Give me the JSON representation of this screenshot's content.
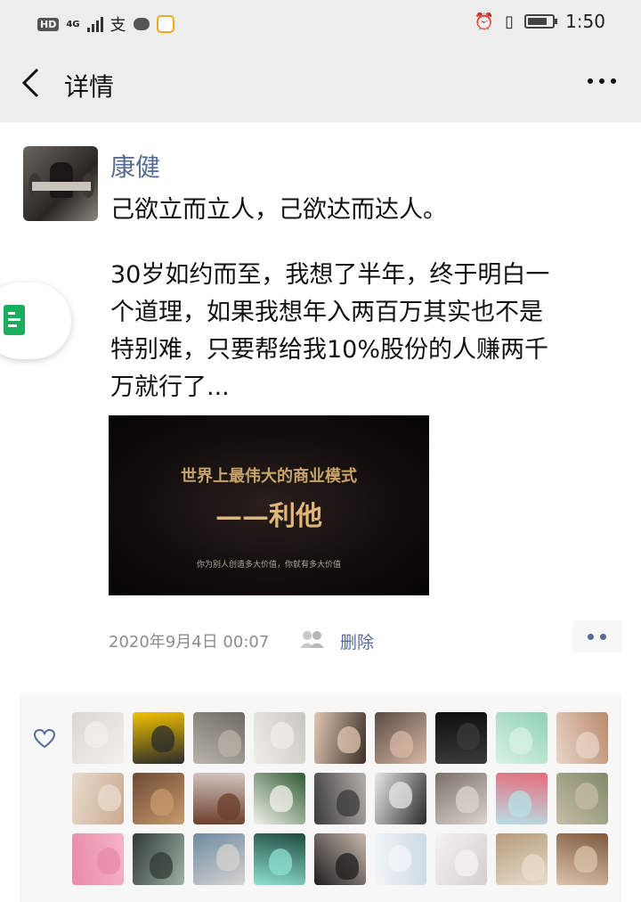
{
  "status_bar": {
    "network": "4G",
    "time": "1:50"
  },
  "nav": {
    "back_icon": "chevron-left-icon",
    "title": "详情",
    "more_icon": "ellipsis-icon"
  },
  "post": {
    "author": "康健",
    "line1": "己欲立而立人，己欲达而达人。",
    "body_lines": [
      "30岁如约而至，我想了半年，终于明白一",
      "个道理，如果我想年入两百万其实也不是",
      "特别难，只要帮给我10%股份的人赚两千",
      "万就行了..."
    ],
    "image": {
      "title": "世界上最伟大的商业模式",
      "main": "——利他",
      "subtitle": "你为别人创造多大价值，你就有多大价值"
    },
    "timestamp": "2020年9月4日 00:07",
    "delete_label": "删除"
  },
  "likes": {
    "avatars": [
      {
        "color": "#dcd7d2",
        "accent": "#f3efe9"
      },
      {
        "color": "#f2c200",
        "accent": "#2b2b2b"
      },
      {
        "color": "#6e6a64",
        "accent": "#b9b3aa"
      },
      {
        "color": "#c9c5bf",
        "accent": "#f1eeea"
      },
      {
        "color": "#3b3029",
        "accent": "#e2c6b2"
      },
      {
        "color": "#5a4c44",
        "accent": "#d7b8a4"
      },
      {
        "color": "#0e0e0e",
        "accent": "#3a3a3a"
      },
      {
        "color": "#8fd1b4",
        "accent": "#d9f2e4"
      },
      {
        "color": "#b98a6d",
        "accent": "#e8d5c7"
      },
      {
        "color": "#caa98f",
        "accent": "#e9dccd"
      },
      {
        "color": "#6d4a34",
        "accent": "#c79a6c"
      },
      {
        "color": "#d4c6c2",
        "accent": "#6b3f2a"
      },
      {
        "color": "#2f5a33",
        "accent": "#f3f3ec"
      },
      {
        "color": "#b5b0ab",
        "accent": "#3a3a3a"
      },
      {
        "color": "#2a2a2a",
        "accent": "#e8e8e8"
      },
      {
        "color": "#7b7069",
        "accent": "#dbd5cf"
      },
      {
        "color": "#e86a7a",
        "accent": "#b5e0e6"
      },
      {
        "color": "#7f8a6a",
        "accent": "#c6bca6"
      },
      {
        "color": "#f4b3c6",
        "accent": "#e88aa6"
      },
      {
        "color": "#9fb1a5",
        "accent": "#2f3a33"
      },
      {
        "color": "#6e8aa2",
        "accent": "#d6d3cf"
      },
      {
        "color": "#1f4a3e",
        "accent": "#8de0d0"
      },
      {
        "color": "#c7b8ad",
        "accent": "#1e1e1e"
      },
      {
        "color": "#cdd9e4",
        "accent": "#f3f6f8"
      },
      {
        "color": "#d4cfcd",
        "accent": "#f5f3f2"
      },
      {
        "color": "#b59b7a",
        "accent": "#e8ddcc"
      },
      {
        "color": "#7d5a40",
        "accent": "#dbc3aa"
      }
    ]
  },
  "colors": {
    "link": "#576b95",
    "bar_bg": "#ededed",
    "panel_bg": "#f7f7f7"
  }
}
